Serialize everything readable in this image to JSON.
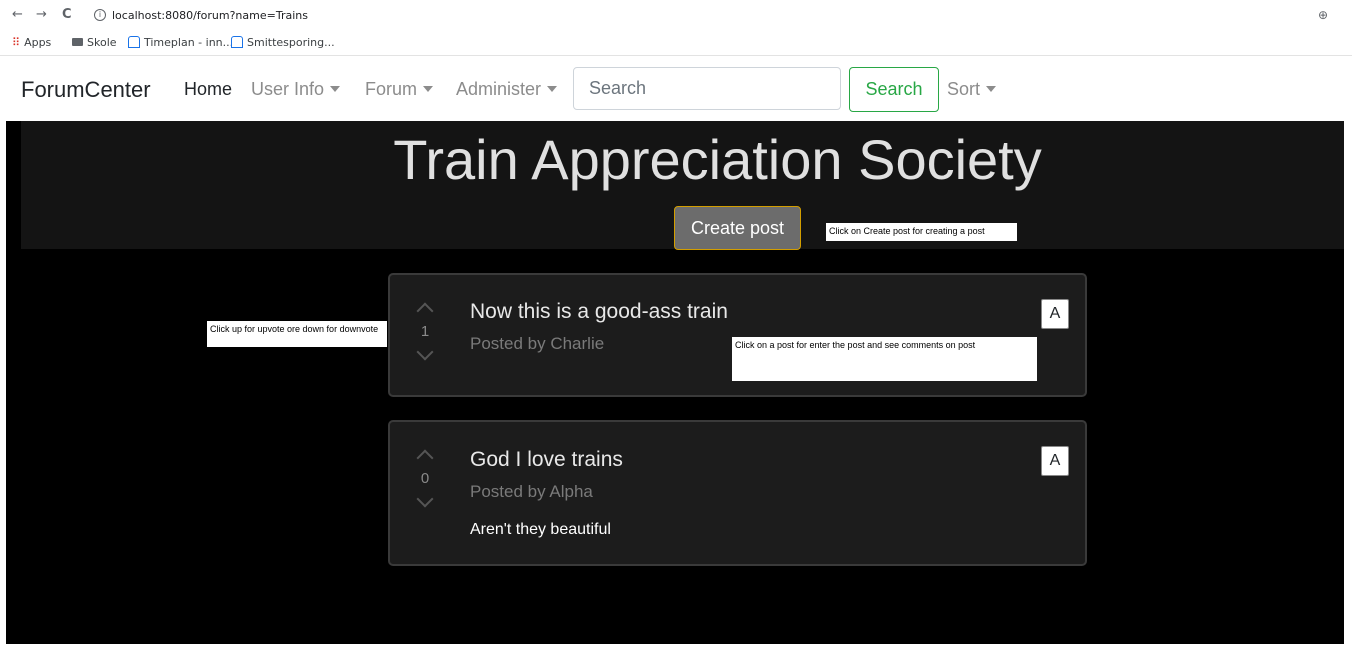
{
  "browser": {
    "back_glyph": "←",
    "forward_glyph": "→",
    "reload_glyph": "C",
    "info_glyph": "i",
    "url": "localhost:8080/forum?name=Trains",
    "zoom_glyph": "⊕",
    "bookmarks": [
      {
        "label": "Apps",
        "icon": "apps-grid-icon"
      },
      {
        "label": "Skole",
        "icon": "folder-icon"
      },
      {
        "label": "Timeplan - inn...",
        "icon": "web-icon"
      },
      {
        "label": "Smittesporing...",
        "icon": "web-icon"
      }
    ]
  },
  "navbar": {
    "brand": "ForumCenter",
    "home": "Home",
    "user_info": "User Info",
    "forum": "Forum",
    "administer": "Administer",
    "search_placeholder": "Search",
    "search_button": "Search",
    "sort": "Sort"
  },
  "forum": {
    "title": "Train Appreciation Society",
    "create_post_label": "Create post"
  },
  "notes": {
    "create": "Click on Create post for creating a post",
    "vote": "Click up for upvote ore down for downvote",
    "post": "Click on a post for enter the post and see comments on post"
  },
  "posts": [
    {
      "votes": "1",
      "title": "Now this is a good-ass train",
      "author": "Posted by Charlie",
      "body": "",
      "action_label": "A"
    },
    {
      "votes": "0",
      "title": "God I love trains",
      "author": "Posted by Alpha",
      "body": "Aren't they beautiful",
      "action_label": "A"
    }
  ],
  "colors": {
    "accent_green": "#28a745",
    "create_border": "#d39e00",
    "page_bg": "#000000",
    "card_bg": "#1c1c1c"
  }
}
